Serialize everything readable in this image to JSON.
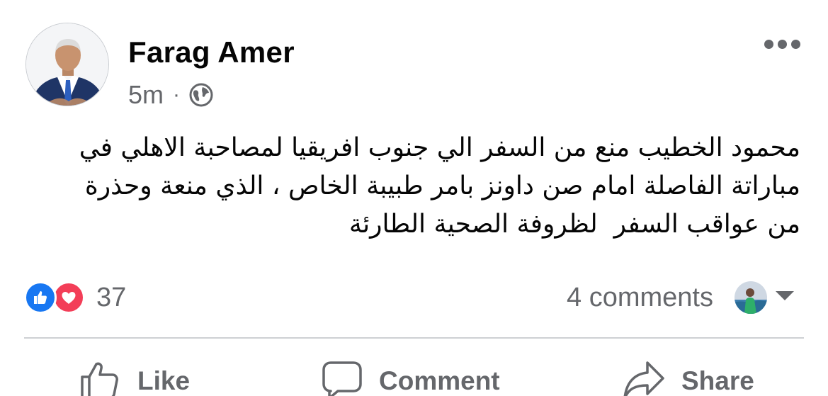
{
  "post": {
    "author": "Farag Amer",
    "time": "5m",
    "separator": "·",
    "privacy_icon": "globe-icon",
    "more_icon": "more-dots-icon",
    "text": "محمود الخطيب منع من السفر الي جنوب افريقيا لمصاحبة الاهلي في مباراتة الفاصلة امام صن داونز بامر طبيبة الخاص ، الذي منعة وحذرة من عواقب السفر  لظروفة الصحية الطارئة"
  },
  "reactions": {
    "icons": [
      "like-reaction-icon",
      "love-reaction-icon"
    ],
    "count": "37",
    "like_color": "#1877f2",
    "love_color": "#f33e58"
  },
  "comments": {
    "summary": "4 comments"
  },
  "actions": {
    "like_label": "Like",
    "comment_label": "Comment",
    "share_label": "Share"
  },
  "colors": {
    "text_primary": "#050505",
    "text_secondary": "#65676b",
    "divider": "#ced0d4"
  }
}
